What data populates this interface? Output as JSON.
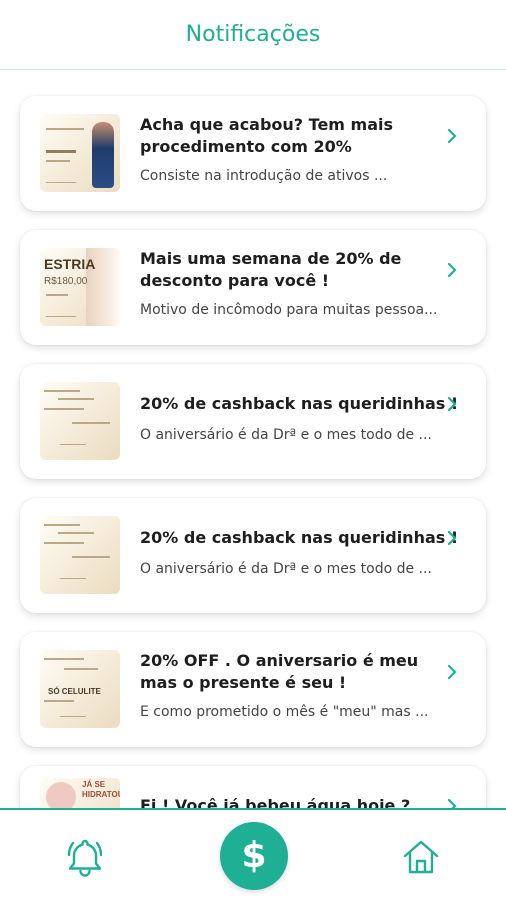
{
  "header": {
    "title": "Notificações"
  },
  "colors": {
    "accent": "#1faf94",
    "text": "#1e1e1e",
    "muted": "#444444"
  },
  "notifications": [
    {
      "title": "Acha que acabou? Tem mais procedimento com 20%",
      "description": "Consiste na introdução de ativos ...",
      "thumb_icon": "promo-banner-image"
    },
    {
      "title": "Mais uma semana de 20% de desconto para você !",
      "description": "Motivo de incômodo para muitas pessoa...",
      "thumb_icon": "promo-banner-image",
      "thumb_texts": {
        "heading": "ESTRIA",
        "price": "R$180,00"
      }
    },
    {
      "title": "20% de cashback nas queridinhas !",
      "description": "O aniversário é da Drª e o mes todo de ...",
      "thumb_icon": "promo-banner-image"
    },
    {
      "title": "20% de cashback nas queridinhas !",
      "description": "O aniversário é da Drª e o mes todo de ...",
      "thumb_icon": "promo-banner-image"
    },
    {
      "title": "20% OFF . O aniversario é meu mas o presente é seu !",
      "description": "E como prometido o mês é \"meu\" mas ...",
      "thumb_icon": "promo-banner-image",
      "thumb_texts": {
        "heading": "SÓ CELULITE"
      }
    },
    {
      "title": "Ei ! Você já bebeu água hoje ?",
      "description": "",
      "thumb_icon": "promo-banner-image",
      "thumb_texts": {
        "heading": "JÁ SE HIDRATOU"
      }
    }
  ],
  "tabbar": {
    "left_icon": "bell-icon",
    "center_icon": "dollar-icon",
    "center_symbol": "$",
    "right_icon": "home-icon"
  }
}
